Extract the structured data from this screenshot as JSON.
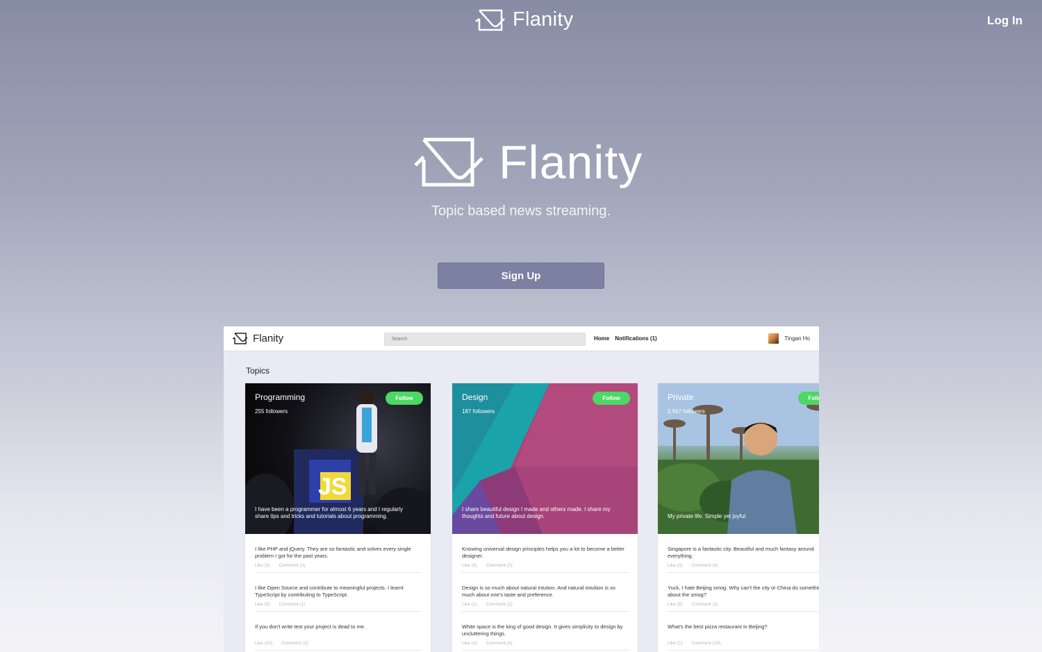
{
  "header": {
    "brand": "Flanity",
    "login_label": "Log In"
  },
  "hero": {
    "brand": "Flanity",
    "tagline": "Topic based news streaming.",
    "signup_label": "Sign Up"
  },
  "preview": {
    "brand": "Flanity",
    "search_placeholder": "Search",
    "nav": {
      "home": "Home",
      "notifications": "Notifications (1)"
    },
    "user_name": "Tingan Ho",
    "topics_heading": "Topics",
    "cards": [
      {
        "title": "Programming",
        "followers": "255 followers",
        "follow_label": "Follow",
        "badge_text": "JS",
        "description": "I have been a programmer for almost 6 years and I regularly share tips and tricks and tutorials about programming.",
        "posts": [
          {
            "text": "I like PHP and jQuery. They are so fantastic and solves every single problem I got for the past years.",
            "like": "Like (2)",
            "comment": "Comment (3)"
          },
          {
            "text": "I like Open Source and contribute to meaningful projects. I learnt TypeScript by contributing to TypeScript.",
            "like": "Like (5)",
            "comment": "Comment (1)"
          },
          {
            "text": "If you don't write test your project is dead to me.",
            "like": "Like (20)",
            "comment": "Comment (2)"
          }
        ]
      },
      {
        "title": "Design",
        "followers": "187 followers",
        "follow_label": "Follow",
        "description": "I share beautiful design I made and others made. I share my thoughts and future about design.",
        "posts": [
          {
            "text": "Knowing universal design principles helps you a lot to become a better designer.",
            "like": "Like (8)",
            "comment": "Comment (2)"
          },
          {
            "text": "Design is so much about natural intution. And natural intuition is so much about one's taste and preference.",
            "like": "Like (1)",
            "comment": "Comment (2)"
          },
          {
            "text": "White space is the king of good design. It gives simplicity to design by uncluttering things.",
            "like": "Like (3)",
            "comment": "Comment (4)"
          }
        ]
      },
      {
        "title": "Private",
        "followers": "2,567 followers",
        "follow_label": "Follow",
        "description": "My private life. Simple yet joyful.",
        "posts": [
          {
            "text": "Singapore is a fantastic city. Beautiful and much fantasy around everything.",
            "like": "Like (3)",
            "comment": "Comment (4)"
          },
          {
            "text": "Yuck, I hate Beijing smog. Why can't the city or China do something about the smog?",
            "like": "Like (5)",
            "comment": "Comment (2)"
          },
          {
            "text": "What's the best pizza restaurant in Beijing?",
            "like": "Like (1)",
            "comment": "Comment (24)"
          }
        ]
      }
    ]
  },
  "colors": {
    "signup_button": "#7c80a1",
    "follow_button": "#4cd864",
    "accent_bg": "#878ca5"
  }
}
